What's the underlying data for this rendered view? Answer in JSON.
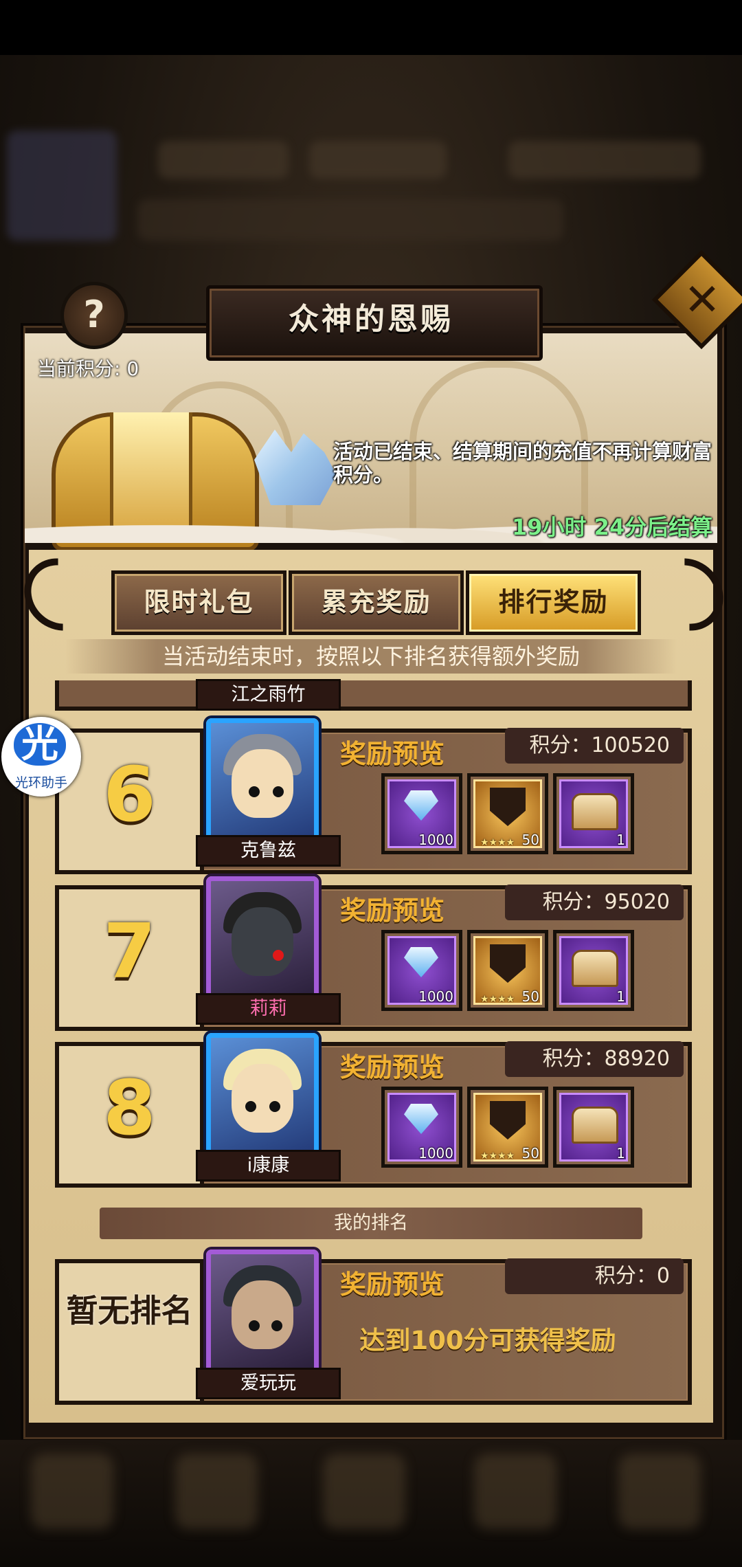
{
  "header": {
    "title": "众神的恩赐",
    "help_icon": "question-mark-icon",
    "close_icon": "close-icon"
  },
  "banner": {
    "score_label": "当前积分:  0",
    "notice": "活动已结束、结算期间的充值不再计算财富积分。",
    "countdown": "19小时 24分后结算"
  },
  "tabs": [
    {
      "label": "限时礼包",
      "active": false
    },
    {
      "label": "累充奖励",
      "active": false
    },
    {
      "label": "排行奖励",
      "active": true
    }
  ],
  "rule_text": "当活动结束时，按照以下排名获得额外奖励",
  "partial_row_name": "江之雨竹",
  "reward_title": "奖励预览",
  "rankings": [
    {
      "rank": "6",
      "name": "克鲁兹",
      "score": "积分：100520",
      "frame": "blue",
      "rewards": [
        {
          "type": "diamond",
          "qty": "1000"
        },
        {
          "type": "token",
          "qty": "50",
          "stars": "★★★★"
        },
        {
          "type": "chest",
          "qty": "1"
        }
      ]
    },
    {
      "rank": "7",
      "name": "莉莉",
      "score": "积分：95020",
      "frame": "purple",
      "rewards": [
        {
          "type": "diamond",
          "qty": "1000"
        },
        {
          "type": "token",
          "qty": "50",
          "stars": "★★★★"
        },
        {
          "type": "chest",
          "qty": "1"
        }
      ]
    },
    {
      "rank": "8",
      "name": "i康康",
      "score": "积分：88920",
      "frame": "blue",
      "rewards": [
        {
          "type": "diamond",
          "qty": "1000"
        },
        {
          "type": "token",
          "qty": "50",
          "stars": "★★★★"
        },
        {
          "type": "chest",
          "qty": "1"
        }
      ]
    }
  ],
  "my_rank": {
    "bar_label": "我的排名",
    "rank_text": "暂无排名",
    "name": "爱玩玩",
    "score": "积分：0",
    "hint": "达到100分可获得奖励"
  },
  "assistant": {
    "icon_text": "光",
    "label": "光环助手"
  },
  "colors": {
    "accent_gold": "#f2b232",
    "countdown_green": "#7cf08a",
    "name_pink": "#ff6fb0"
  }
}
